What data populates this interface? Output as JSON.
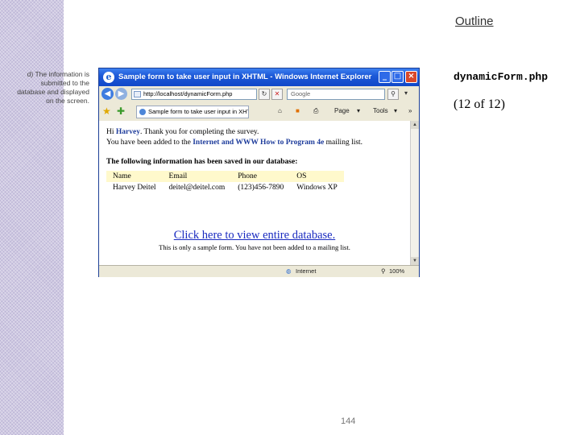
{
  "slide": {
    "outline_link": "Outline",
    "caption": "d) The information is submitted to the database and displayed on the screen.",
    "filename": "dynamicForm.php",
    "slide_counter": "(12 of 12)",
    "page_number": "144"
  },
  "browser": {
    "title": "Sample form to take user input in XHTML - Windows Internet Explorer",
    "address": "http://localhost/dynamicForm.php",
    "search_placeholder": "Google",
    "tab_label": "Sample form to take user input in XHT...",
    "page_menu": "Page",
    "tools_menu": "Tools",
    "status_zone": "Internet",
    "zoom": "100%",
    "icons": {
      "back": "back-arrow-icon",
      "forward": "forward-arrow-icon",
      "refresh": "refresh-icon",
      "stop": "stop-icon",
      "search": "magnifier-icon",
      "favorites": "star-icon",
      "add_favorites": "add-favorite-icon",
      "home": "home-icon",
      "feeds": "feeds-icon",
      "print": "printer-icon"
    }
  },
  "page": {
    "greeting_prefix": "Hi ",
    "greeting_name": "Harvey",
    "greeting_suffix": ". Thank you for completing the survey.",
    "added_prefix": "You have been added to the ",
    "mailing_list": "Internet and WWW How to Program 4e",
    "added_suffix": " mailing list.",
    "saved_heading": "The following information has been saved in our database:",
    "table": {
      "headers": [
        "Name",
        "Email",
        "Phone",
        "OS"
      ],
      "rows": [
        [
          "Harvey Deitel",
          "deitel@deitel.com",
          "(123)456-7890",
          "Windows XP"
        ]
      ]
    },
    "view_link": "Click here to view entire database.",
    "note": "This is only a sample form. You have not been added to a mailing list."
  }
}
